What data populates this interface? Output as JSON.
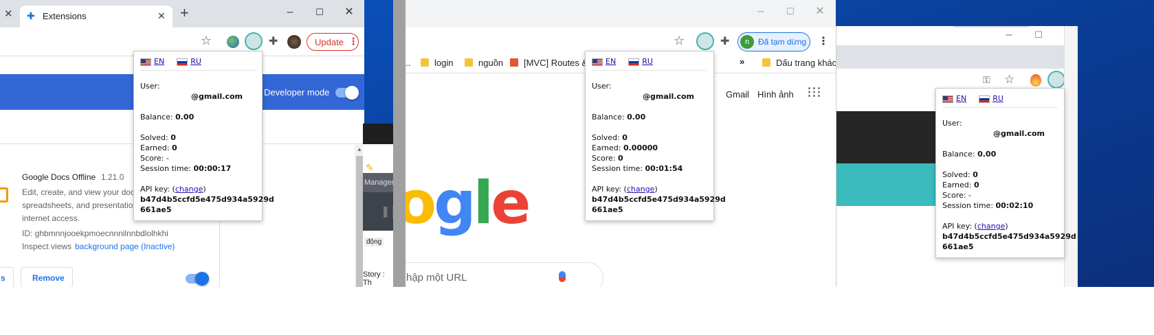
{
  "window1": {
    "tab_title": "Extensions",
    "update_button": "Update",
    "developer_mode_label": "Developer mode",
    "extension": {
      "name": "Google Docs Offline",
      "version": "1.21.0",
      "description_lines": [
        "Edit, create, and view your doc",
        "spreadsheets, and presentation",
        "internet access."
      ],
      "id_text": "ID: ghbmnnjooekpmoecnnnilnnbdlolhkhi",
      "inspect_label": "Inspect views",
      "inspect_link": "background page (Inactive)",
      "details_button": "s",
      "remove_button": "Remove"
    }
  },
  "taskbar_fragment": {
    "manager_text": "Manager",
    "tag_text": "động",
    "story_text": "Story : Th"
  },
  "window2": {
    "bookmarks": [
      "..",
      "login",
      "nguồn",
      "[MVC] Routes & C",
      "Dấu trang khác"
    ],
    "profile_label": "Đã tạm dừng",
    "profile_initial": "n",
    "links": [
      "Gmail",
      "Hình ảnh"
    ],
    "logo_text": "ogle",
    "search_placeholder": "hập một URL"
  },
  "popups": [
    {
      "lang_en": "EN",
      "lang_ru": "RU",
      "user_label": "User:",
      "email": "@gmail.com",
      "balance_label": "Balance:",
      "balance": "0.00",
      "solved_label": "Solved:",
      "solved": "0",
      "earned_label": "Earned:",
      "earned": "0",
      "score_label": "Score:",
      "score": "-",
      "session_label": "Session time:",
      "session": "00:00:17",
      "api_label": "API key:",
      "change_label": "change",
      "api_key_1": "b47d4b5ccfd5e475d934a5929d",
      "api_key_2": "661ae5"
    },
    {
      "lang_en": "EN",
      "lang_ru": "RU",
      "user_label": "User:",
      "email": "@gmail.com",
      "balance_label": "Balance:",
      "balance": "0.00",
      "solved_label": "Solved:",
      "solved": "0",
      "earned_label": "Earned:",
      "earned": "0.00000",
      "score_label": "Score:",
      "score": "0",
      "session_label": "Session time:",
      "session": "00:01:54",
      "api_label": "API key:",
      "change_label": "change",
      "api_key_1": "b47d4b5ccfd5e475d934a5929d",
      "api_key_2": "661ae5"
    },
    {
      "lang_en": "EN",
      "lang_ru": "RU",
      "user_label": "User:",
      "email": "@gmail.com",
      "balance_label": "Balance:",
      "balance": "0.00",
      "solved_label": "Solved:",
      "solved": "0",
      "earned_label": "Earned:",
      "earned": "0",
      "score_label": "Score:",
      "score": "-",
      "session_label": "Session time:",
      "session": "00:02:10",
      "api_label": "API key:",
      "change_label": "change",
      "api_key_1": "b47d4b5ccfd5e475d934a5929d",
      "api_key_2": "661ae5"
    }
  ],
  "colors": {
    "chrome_blue": "#3367d6",
    "update_red": "#d93025",
    "teal": "#3bbbbd",
    "dark": "#262626",
    "extension_teal": "#3fb5b5"
  }
}
